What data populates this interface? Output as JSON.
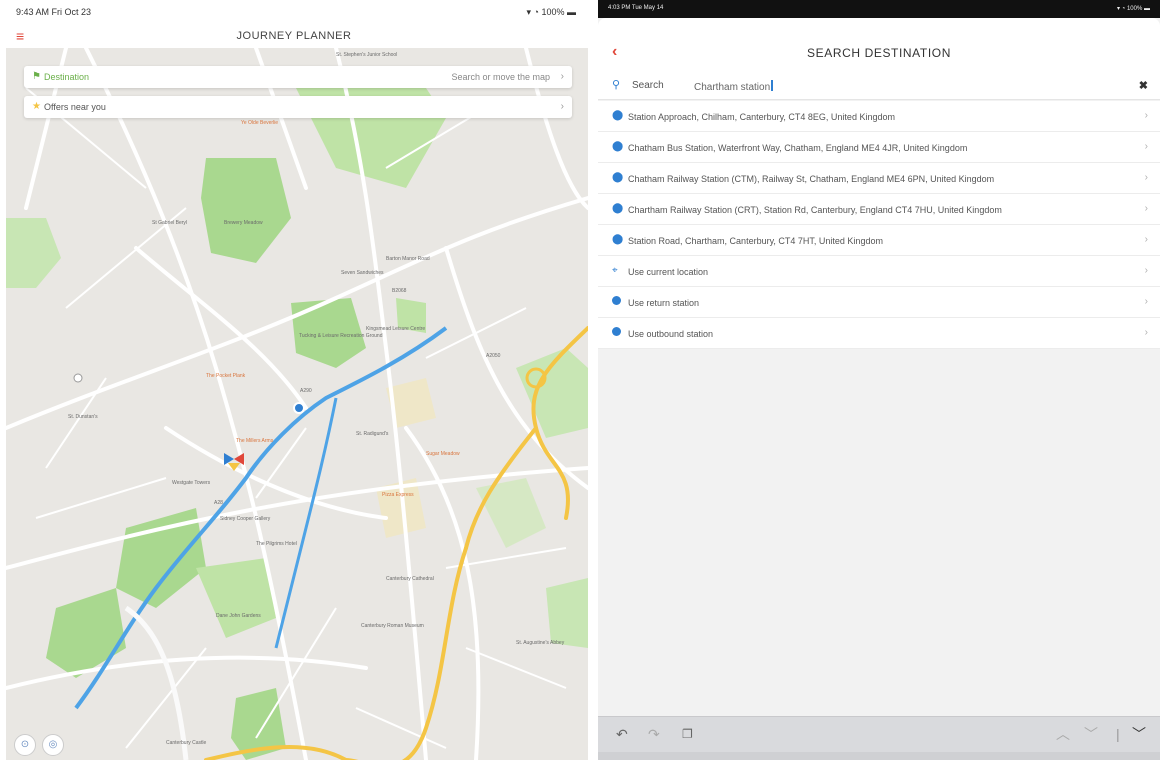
{
  "left": {
    "status_time": "9:43 AM  Fri Oct 23",
    "status_right": "100%",
    "title": "JOURNEY PLANNER",
    "menu_icon": "hamburger-icon",
    "destination_label": "Destination",
    "destination_hint": "Search or move the map",
    "offers_label": "Offers near you",
    "map_labels": [
      "St. Stephen's Junior School",
      "Ye Olde Beverlie",
      "St Gabriel Beryl",
      "Brewery Meadow",
      "Barton Manor Road",
      "Seven Sandwiches",
      "Kingsmead Leisure Centre",
      "Tucking & Leisure Recreation Ground",
      "The Pocket Plank",
      "St. Dunstan's",
      "The Millers Arms",
      "St. Radigund's",
      "Sugar Meadow",
      "Westgate Towers",
      "Pizza Express",
      "Sidney Cooper Gallery",
      "The Pilgrims Hotel",
      "Canterbury Cathedral",
      "Canterbury Roman Museum",
      "Dane John Gardens",
      "St. Augustine's Abbey",
      "Canterbury Castle",
      "A28",
      "B2068",
      "A290",
      "A2050"
    ]
  },
  "right": {
    "status_time": "4:03 PM  Tue May 14",
    "status_right": "100%",
    "title": "SEARCH DESTINATION",
    "search_label": "Search",
    "search_value": "Chartham station",
    "results": [
      {
        "icon": "pin-icon",
        "text": "Station Approach, Chilham, Canterbury, CT4 8EG, United Kingdom"
      },
      {
        "icon": "pin-icon",
        "text": "Chatham Bus Station, Waterfront Way, Chatham, England ME4 4JR, United Kingdom"
      },
      {
        "icon": "pin-icon",
        "text": "Chatham Railway Station (CTM), Railway St, Chatham, England ME4 6PN, United Kingdom"
      },
      {
        "icon": "pin-icon",
        "text": "Chartham Railway Station (CRT), Station Rd, Canterbury, England CT4 7HU, United Kingdom"
      },
      {
        "icon": "pin-icon",
        "text": "Station Road, Chartham, Canterbury, CT4 7HT, United Kingdom"
      },
      {
        "icon": "crosshair-icon",
        "text": "Use current location"
      },
      {
        "icon": "station-dot-icon",
        "text": "Use return station"
      },
      {
        "icon": "station-dot-icon",
        "text": "Use outbound station"
      }
    ]
  },
  "colors": {
    "accent_red": "#e0473a",
    "accent_blue": "#2f7fd1",
    "accent_green": "#6bb04a"
  }
}
